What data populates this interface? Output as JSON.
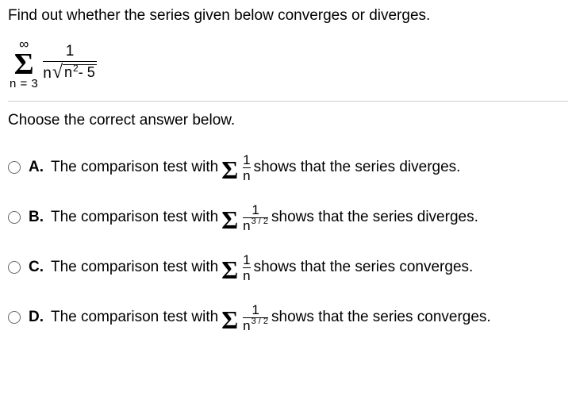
{
  "question": "Find out whether the series given below converges or diverges.",
  "series": {
    "sigma_top": "∞",
    "sigma_bottom": "n = 3",
    "numerator": "1",
    "den_coeff": "n",
    "sqrt_inner_base": "n",
    "sqrt_inner_exp": "2",
    "sqrt_tail": " - 5"
  },
  "instruction": "Choose the correct answer below.",
  "options": [
    {
      "letter": "A.",
      "pre": "The comparison test with ",
      "frac_num": "1",
      "frac_den_base": "n",
      "frac_den_exp": "",
      "post": " shows that the series diverges."
    },
    {
      "letter": "B.",
      "pre": "The comparison test with ",
      "frac_num": "1",
      "frac_den_base": "n",
      "frac_den_exp": "3 / 2",
      "post": " shows that the series diverges."
    },
    {
      "letter": "C.",
      "pre": "The comparison test with ",
      "frac_num": "1",
      "frac_den_base": "n",
      "frac_den_exp": "",
      "post": " shows that the series converges."
    },
    {
      "letter": "D.",
      "pre": "The comparison test with ",
      "frac_num": "1",
      "frac_den_base": "n",
      "frac_den_exp": "3 / 2",
      "post": " shows that the series converges."
    }
  ]
}
